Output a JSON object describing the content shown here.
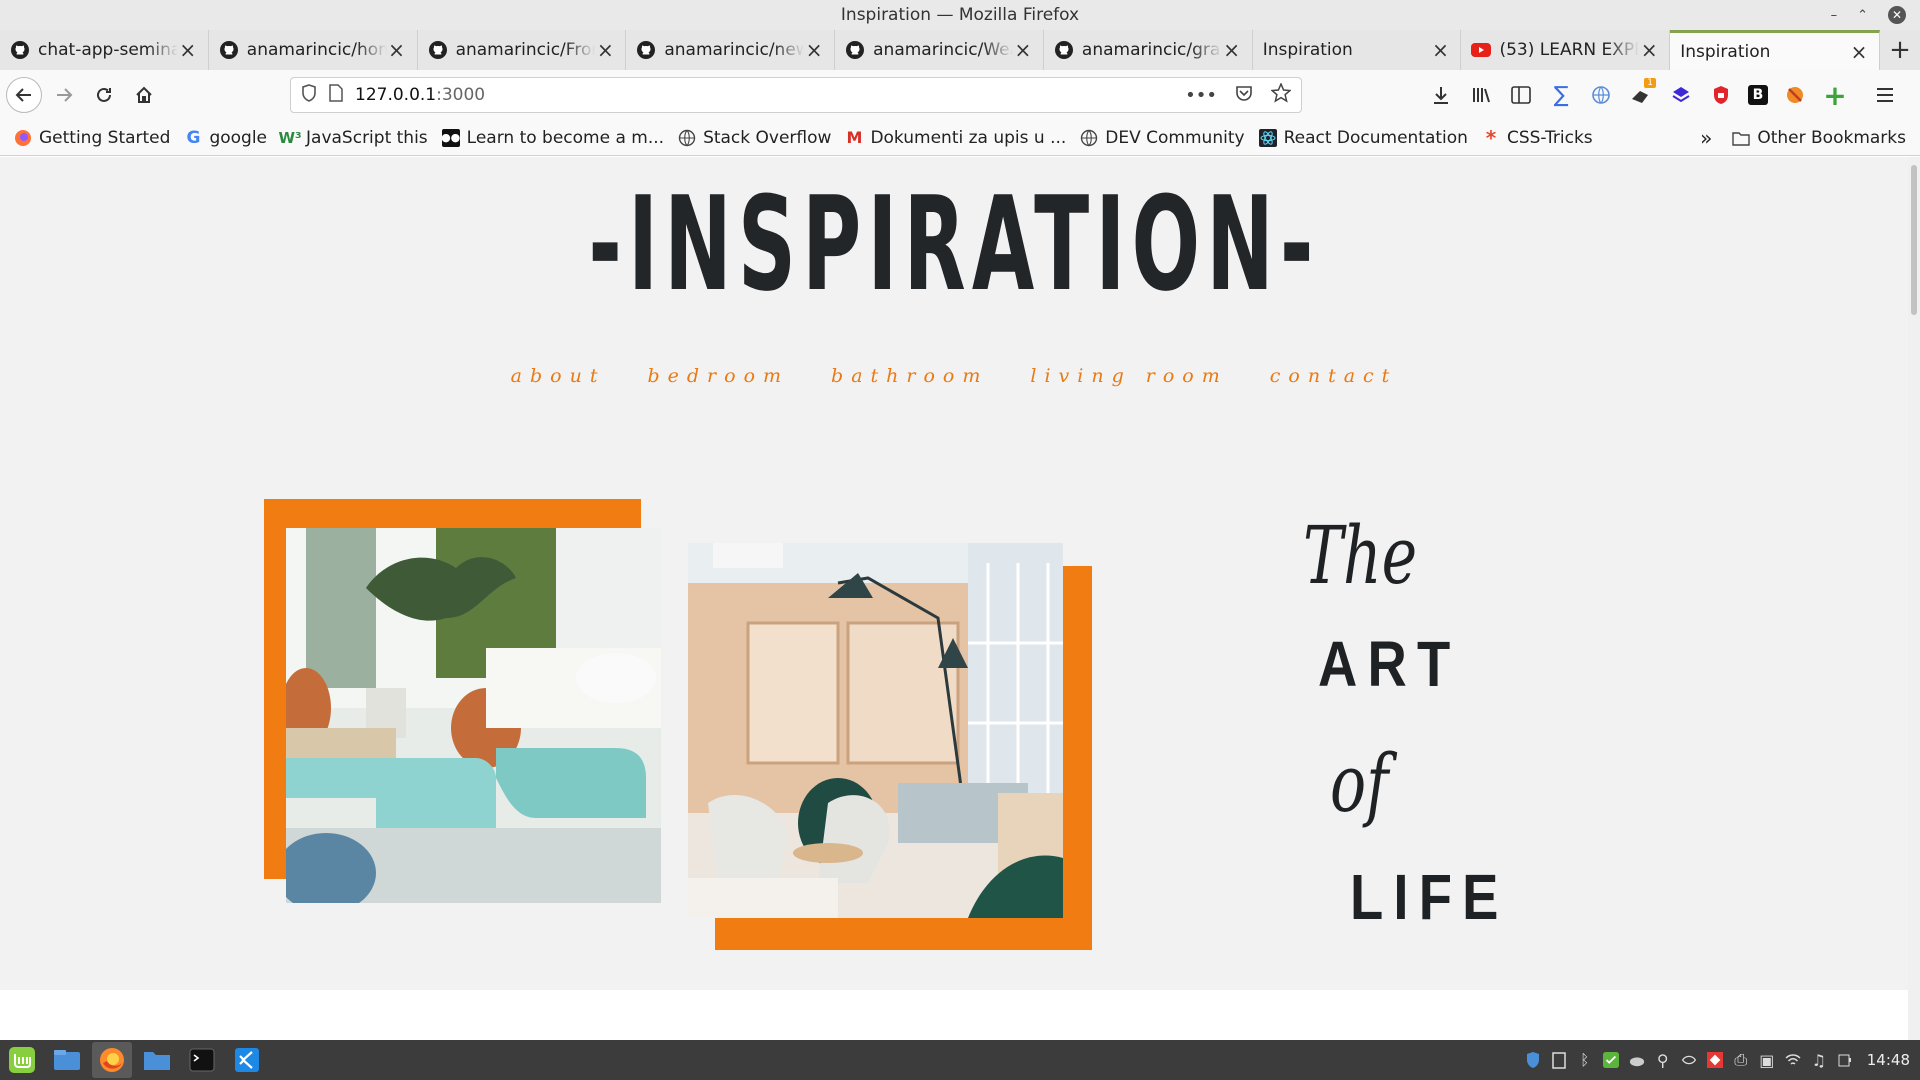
{
  "window": {
    "title": "Inspiration — Mozilla Firefox"
  },
  "tabs": [
    {
      "label": "chat-app-seminar",
      "icon": "github-icon"
    },
    {
      "label": "anamarincic/hom",
      "icon": "github-icon"
    },
    {
      "label": "anamarincic/Fron",
      "icon": "github-icon"
    },
    {
      "label": "anamarincic/new",
      "icon": "github-icon"
    },
    {
      "label": "anamarincic/Wea",
      "icon": "github-icon"
    },
    {
      "label": "anamarincic/grab",
      "icon": "github-icon"
    },
    {
      "label": "Inspiration",
      "icon": "none"
    },
    {
      "label": "(53) LEARN EXPR",
      "icon": "youtube-icon"
    },
    {
      "label": "Inspiration",
      "icon": "none"
    }
  ],
  "address": {
    "host": "127.0.0.1",
    "port": ":3000"
  },
  "bookmarks": [
    {
      "label": "Getting Started",
      "icon": "firefox-icon"
    },
    {
      "label": "google",
      "icon": "google-icon"
    },
    {
      "label": "JavaScript this",
      "icon": "w3-icon"
    },
    {
      "label": "Learn to become a m...",
      "icon": "medium-icon"
    },
    {
      "label": "Stack Overflow",
      "icon": "globe-icon"
    },
    {
      "label": "Dokumenti za upis u ...",
      "icon": "gmail-icon"
    },
    {
      "label": "DEV Community",
      "icon": "globe-icon"
    },
    {
      "label": "React Documentation",
      "icon": "react-icon"
    },
    {
      "label": "CSS-Tricks",
      "icon": "star-icon"
    }
  ],
  "bookmarks_other": "Other Bookmarks",
  "page": {
    "title": "-INSPIRATION-",
    "menu": [
      "about",
      "bedroom",
      "bathroom",
      "living room",
      "contact"
    ],
    "art": {
      "the": "The",
      "art": "ART",
      "of": "of",
      "life": "LIFE"
    },
    "accent": "#f07c12",
    "background": "#f2f2f2"
  },
  "taskbar": {
    "clock": "14:48"
  }
}
